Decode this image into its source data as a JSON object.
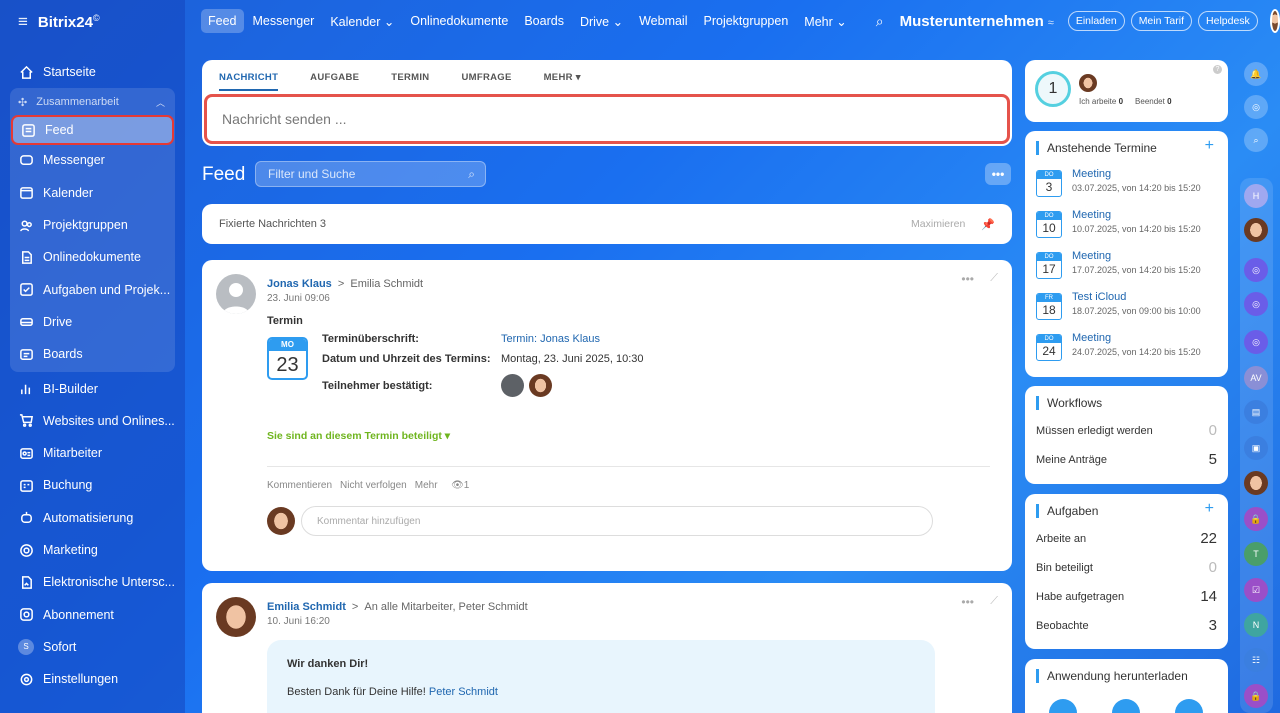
{
  "app": {
    "logo": "Bitrix24",
    "logo_mark": "©"
  },
  "sidebar": {
    "top": [
      {
        "label": "Startseite",
        "icon": "home-icon"
      }
    ],
    "group": {
      "label": "Zusammenarbeit",
      "items": [
        {
          "label": "Feed",
          "icon": "feed-icon",
          "active": true
        },
        {
          "label": "Messenger",
          "icon": "chat-icon"
        },
        {
          "label": "Kalender",
          "icon": "calendar-icon"
        },
        {
          "label": "Projektgruppen",
          "icon": "group-icon"
        },
        {
          "label": "Onlinedokumente",
          "icon": "document-icon"
        },
        {
          "label": "Aufgaben und Projek...",
          "icon": "task-icon"
        },
        {
          "label": "Drive",
          "icon": "drive-icon"
        },
        {
          "label": "Boards",
          "icon": "board-icon"
        }
      ]
    },
    "items": [
      {
        "label": "BI-Builder",
        "icon": "chart-icon"
      },
      {
        "label": "Websites und Onlines...",
        "icon": "cart-icon"
      },
      {
        "label": "Mitarbeiter",
        "icon": "employee-icon"
      },
      {
        "label": "Buchung",
        "icon": "booking-icon"
      },
      {
        "label": "Automatisierung",
        "icon": "robot-icon"
      },
      {
        "label": "Marketing",
        "icon": "target-icon"
      },
      {
        "label": "Elektronische Untersc...",
        "icon": "signature-icon"
      },
      {
        "label": "Abonnement",
        "icon": "subscription-icon"
      },
      {
        "label": "Sofort",
        "icon": "s-badge"
      },
      {
        "label": "Einstellungen",
        "icon": "gear-icon"
      }
    ]
  },
  "topbar": {
    "tabs": [
      "Feed",
      "Messenger",
      "Kalender",
      "Onlinedokumente",
      "Boards",
      "Drive",
      "Webmail",
      "Projektgruppen",
      "Mehr"
    ],
    "company": "Musterunternehmen",
    "buttons": [
      "Einladen",
      "Mein Tarif",
      "Helpdesk"
    ]
  },
  "composer": {
    "tabs": [
      "NACHRICHT",
      "AUFGABE",
      "TERMIN",
      "UMFRAGE",
      "MEHR"
    ],
    "placeholder": "Nachricht senden ..."
  },
  "feed": {
    "title": "Feed",
    "filter_placeholder": "Filter und Suche",
    "more": "•••"
  },
  "pinned": {
    "label": "Fixierte Nachrichten",
    "count": "3",
    "maximize": "Maximieren"
  },
  "post1": {
    "author": "Jonas Klaus",
    "recipient": "Emilia Schmidt",
    "date": "23. Juni 09:06",
    "type": "Termin",
    "cal_dow": "MO",
    "cal_day": "23",
    "rows": [
      {
        "label": "Terminüberschrift:",
        "value": "Termin: Jonas Klaus"
      },
      {
        "label": "Datum und Uhrzeit des Termins:",
        "value": "Montag, 23. Juni 2025, 10:30"
      },
      {
        "label": "Teilnehmer bestätigt:",
        "value": ""
      }
    ],
    "involved": "Sie sind an diesem Termin beteiligt",
    "actions": [
      "Kommentieren",
      "Nicht verfolgen",
      "Mehr"
    ],
    "views": "1",
    "comment_placeholder": "Kommentar hinzufügen"
  },
  "post2": {
    "author": "Emilia Schmidt",
    "recipient": "An alle Mitarbeiter, Peter Schmidt",
    "date": "10. Juni 16:20",
    "thanks_title": "Wir danken Dir!",
    "thanks_text": "Besten Dank für Deine Hilfe!",
    "thanks_link": "Peter Schmidt"
  },
  "work": {
    "count": "1",
    "working_label": "Ich arbeite",
    "working": "0",
    "done_label": "Beendet",
    "done": "0"
  },
  "events": {
    "title": "Anstehende Termine",
    "items": [
      {
        "dow": "DO",
        "day": "3",
        "title": "Meeting",
        "time": "03.07.2025, von 14:20 bis 15:20"
      },
      {
        "dow": "DO",
        "day": "10",
        "title": "Meeting",
        "time": "10.07.2025, von 14:20 bis 15:20"
      },
      {
        "dow": "DO",
        "day": "17",
        "title": "Meeting",
        "time": "17.07.2025, von 14:20 bis 15:20"
      },
      {
        "dow": "FR",
        "day": "18",
        "title": "Test iCloud",
        "time": "18.07.2025, von 09:00 bis 10:00"
      },
      {
        "dow": "DO",
        "day": "24",
        "title": "Meeting",
        "time": "24.07.2025, von 14:20 bis 15:20"
      }
    ]
  },
  "workflows": {
    "title": "Workflows",
    "rows": [
      {
        "label": "Müssen erledigt werden",
        "value": "0"
      },
      {
        "label": "Meine Anträge",
        "value": "5"
      }
    ]
  },
  "tasks": {
    "title": "Aufgaben",
    "rows": [
      {
        "label": "Arbeite an",
        "value": "22"
      },
      {
        "label": "Bin beteiligt",
        "value": "0"
      },
      {
        "label": "Habe aufgetragen",
        "value": "14"
      },
      {
        "label": "Beobachte",
        "value": "3"
      }
    ]
  },
  "download": {
    "title": "Anwendung herunterladen"
  },
  "rightbar": {
    "letters": [
      "H",
      "AV",
      "T",
      "N"
    ]
  }
}
